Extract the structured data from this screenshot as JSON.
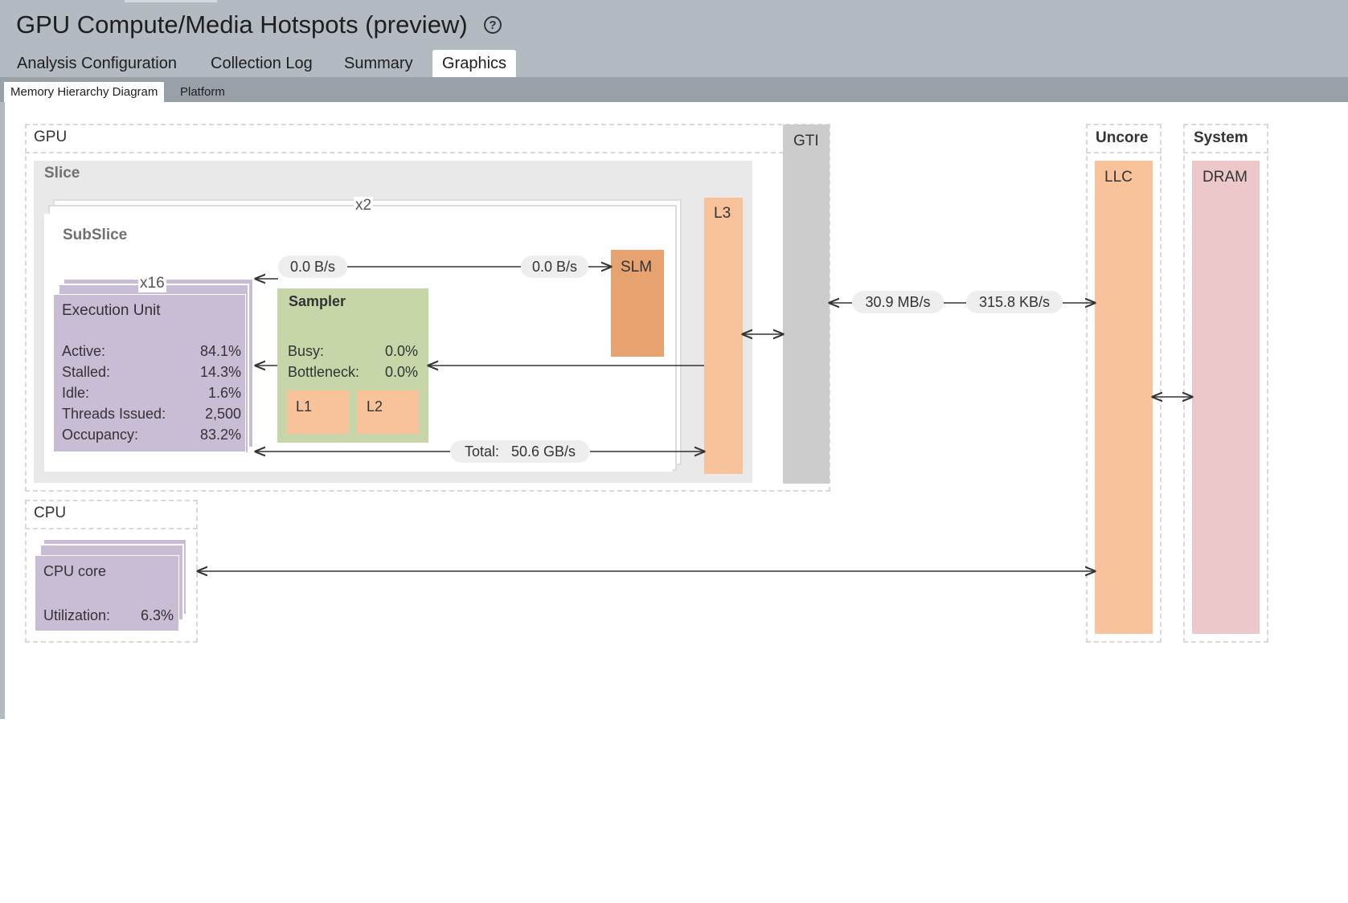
{
  "header": {
    "title": "GPU Compute/Media Hotspots (preview)",
    "help_icon": "question-circle-icon",
    "tabs": [
      {
        "label": "Analysis Configuration",
        "active": false
      },
      {
        "label": "Collection Log",
        "active": false
      },
      {
        "label": "Summary",
        "active": false
      },
      {
        "label": "Graphics",
        "active": true
      }
    ]
  },
  "subtabs": [
    {
      "label": "Memory Hierarchy Diagram",
      "active": true
    },
    {
      "label": "Platform",
      "active": false
    }
  ],
  "diagram": {
    "gpu": {
      "label": "GPU",
      "gti_label": "GTI",
      "slice": {
        "label": "Slice",
        "multiplier": "x2",
        "l3_label": "L3",
        "subslice": {
          "label": "SubSlice",
          "eu": {
            "multiplier": "x16",
            "title": "Execution Unit",
            "metrics": [
              {
                "label": "Active:",
                "value": "84.1%"
              },
              {
                "label": "Stalled:",
                "value": "14.3%"
              },
              {
                "label": "Idle:",
                "value": "1.6%"
              },
              {
                "label": "Threads Issued:",
                "value": "2,500"
              },
              {
                "label": "Occupancy:",
                "value": "83.2%"
              }
            ]
          },
          "sampler": {
            "title": "Sampler",
            "metrics": [
              {
                "label": "Busy:",
                "value": "0.0%"
              },
              {
                "label": "Bottleneck:",
                "value": "0.0%"
              }
            ],
            "l1_label": "L1",
            "l2_label": "L2"
          },
          "slm_label": "SLM",
          "slm_read": "0.0 B/s",
          "slm_write": "0.0 B/s",
          "total_label": "Total:",
          "total_value": "50.6 GB/s"
        }
      },
      "gti_read": "30.9 MB/s",
      "gti_write": "315.8 KB/s"
    },
    "cpu": {
      "label": "CPU",
      "core_title": "CPU core",
      "util_label": "Utilization:",
      "util_value": "6.3%"
    },
    "uncore": {
      "label": "Uncore",
      "llc_label": "LLC"
    },
    "system": {
      "label": "System",
      "dram_label": "DRAM"
    },
    "colors": {
      "eu": "#c9bdd6",
      "sampler": "#c6d6a9",
      "cache": "#f8c29b",
      "slm": "#e6a26f",
      "gti": "#cccccc",
      "dram": "#ecc8c9",
      "slice_bg": "#e9e9e9",
      "header_bg": "#b4bac1"
    }
  }
}
